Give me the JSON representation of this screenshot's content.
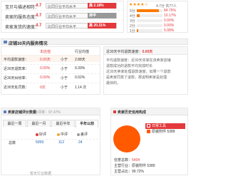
{
  "dsr": {
    "rows": [
      {
        "label": "宝贝与描述相符：",
        "score": "4.7",
        "compare": "比同行业平均水平",
        "percent": "2.18%",
        "trend": "up"
      },
      {
        "label": "卖家的服务态度：",
        "score": "4.7",
        "compare": "比同行业平均水平",
        "percent": "持平",
        "trend": "flat"
      },
      {
        "label": "卖家发货的速度：",
        "score": "4.7",
        "compare": "比同行业平均水平",
        "percent": "20.31%",
        "trend": "up"
      }
    ]
  },
  "rating": {
    "score_text": "4.7分 共77人",
    "stars": "★★★★☆",
    "rows": [
      {
        "label": "5分",
        "value": "84.75%",
        "fraction": 0.85
      },
      {
        "label": "4分",
        "value": "10.17%",
        "fraction": 0.1
      },
      {
        "label": "3分",
        "value": "0.00%",
        "fraction": 0.0
      },
      {
        "label": "2分",
        "value": "0.00%",
        "fraction": 0.0
      },
      {
        "label": "1分",
        "value": "5.08%",
        "fraction": 0.05
      }
    ]
  },
  "service": {
    "title": "店铺30天内服务情况",
    "headers": {
      "own": "本店值",
      "industry": "行业均值"
    },
    "rows": [
      {
        "label": "平均退款速度：",
        "value": "0.00天",
        "cmp": "小于",
        "industry": "2.88天"
      },
      {
        "label": "近30天退款率：",
        "value": "0.00%",
        "cmp": "小于",
        "industry": "9.39%"
      },
      {
        "label": "近30天纠纷率：",
        "value": "0.00%",
        "cmp": "小于",
        "industry": "0.02%"
      },
      {
        "label": "近30天处罚数：",
        "value": "0次",
        "cmp": "小于",
        "industry": "1.14 次"
      }
    ],
    "refund_title": "近30天平均退款速度：",
    "refund_value": "0.00天",
    "refund_lines": [
      "平均退款速度：近30天买家在该卖家店铺",
      "退款成功的退款平均完成时长",
      "近30天卖家处理退款速度，如果一个退款",
      "是卖家同意了退款，那说明卖家是处理",
      "最快的。"
    ]
  },
  "evaluation": {
    "title": "卖家店铺评价数量",
    "subtitle": "好评率：97.47%",
    "tabs": [
      "最近一周",
      "最近一月",
      "最近半年",
      "半年以前"
    ],
    "columns": [
      "",
      "好评",
      "中评",
      "差评"
    ],
    "totals": {
      "label": "总数",
      "good": "5059",
      "mid": "112",
      "bad": "24"
    },
    "footer": "暂无行业数据",
    "colors": {
      "good": "#e4393c",
      "mid": "#f3a83b",
      "bad": "#999999"
    }
  },
  "history": {
    "title": "卖家历史信用构成",
    "legend": [
      {
        "label": "日常工具",
        "color": "#e4393c"
      },
      {
        "label": "原装附件",
        "value": "5389",
        "color": "#ff5a00"
      }
    ],
    "lines": [
      {
        "label": "信誉总数：",
        "value": "5404"
      },
      {
        "label": "主营行业：",
        "value": "原装附件 5389"
      },
      {
        "label": "主营占比：",
        "value": "99.72%"
      }
    ],
    "pie_color": "#ff5a00"
  }
}
